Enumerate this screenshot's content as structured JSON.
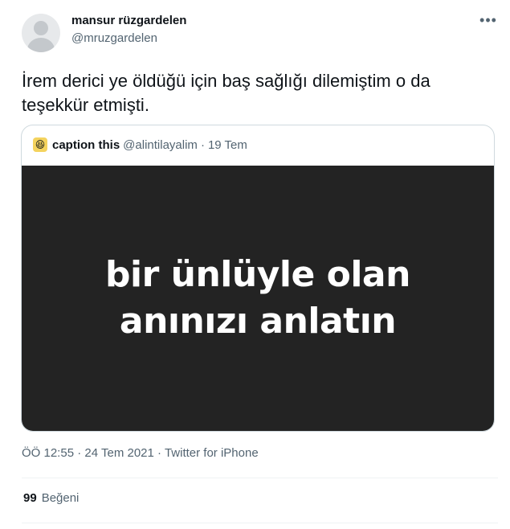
{
  "author": {
    "name": "mansur rüzgardelen",
    "handle": "@mruzgardelen"
  },
  "more_icon": "more-horizontal-icon",
  "tweet_text": "İrem derici ye öldüğü için baş sağlığı dilemiştim o da teşekkür etmişti.",
  "quote": {
    "avatar_emoji": "😆",
    "name": "caption this",
    "handle": "@alintilayalim",
    "separator": "·",
    "date": "19 Tem",
    "image_lines": [
      "bir ünlüyle olan",
      "anınızı anlatın"
    ]
  },
  "meta": {
    "time": "ÖÖ 12:55",
    "separator1": "·",
    "date": "24 Tem 2021",
    "separator2": "·",
    "source": "Twitter for iPhone"
  },
  "likes": {
    "count": "99",
    "label": "Beğeni"
  },
  "colors": {
    "text": "#0f1419",
    "secondary": "#536471",
    "border": "#cfd9de",
    "media_bg": "#232323"
  }
}
